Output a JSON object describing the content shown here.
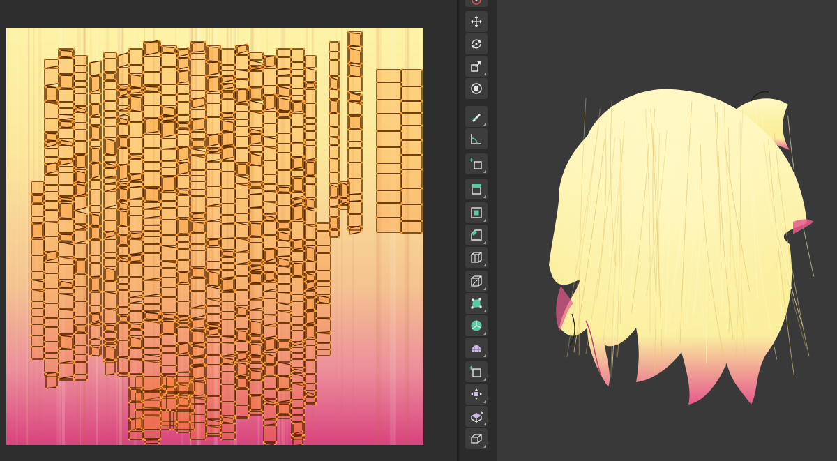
{
  "uv_editor": {
    "texture_gradient": [
      "#fdf3a6",
      "#fce79a",
      "#f4c390",
      "#ec8f9b",
      "#d9437e"
    ],
    "island_outline_color": "#5a2a00",
    "island_fill_color": "#ff8a1f",
    "vertex_color": "#ff9c2a"
  },
  "toolbar": {
    "tools": [
      {
        "name": "cursor-icon",
        "group": "transform"
      },
      {
        "name": "move-icon",
        "group": "transform"
      },
      {
        "name": "rotate-icon",
        "group": "transform"
      },
      {
        "name": "scale-icon",
        "group": "transform"
      },
      {
        "name": "transform-icon",
        "group": "transform"
      },
      {
        "name": "annotate-icon",
        "group": "annotate"
      },
      {
        "name": "measure-icon",
        "group": "annotate"
      },
      {
        "name": "add-cube-icon",
        "group": "add"
      },
      {
        "name": "extrude-region-icon",
        "group": "mesh"
      },
      {
        "name": "inset-faces-icon",
        "group": "mesh"
      },
      {
        "name": "bevel-icon",
        "group": "mesh"
      },
      {
        "name": "loop-cut-icon",
        "group": "mesh"
      },
      {
        "name": "knife-icon",
        "group": "mesh"
      },
      {
        "name": "poly-build-icon",
        "group": "mesh"
      },
      {
        "name": "spin-icon",
        "group": "mesh"
      },
      {
        "name": "smooth-icon",
        "group": "mesh"
      },
      {
        "name": "edge-slide-icon",
        "group": "mesh"
      },
      {
        "name": "shrink-fatten-icon",
        "group": "mesh"
      },
      {
        "name": "shear-icon",
        "group": "mesh"
      },
      {
        "name": "rip-region-icon",
        "group": "mesh"
      }
    ]
  },
  "viewport": {
    "background_color": "#393939",
    "hair_base_color": "#fbef9e",
    "hair_highlight_color": "#fff8c4",
    "hair_shadow_color": "#e6c973",
    "hair_tip_color": "#e65a8c"
  }
}
